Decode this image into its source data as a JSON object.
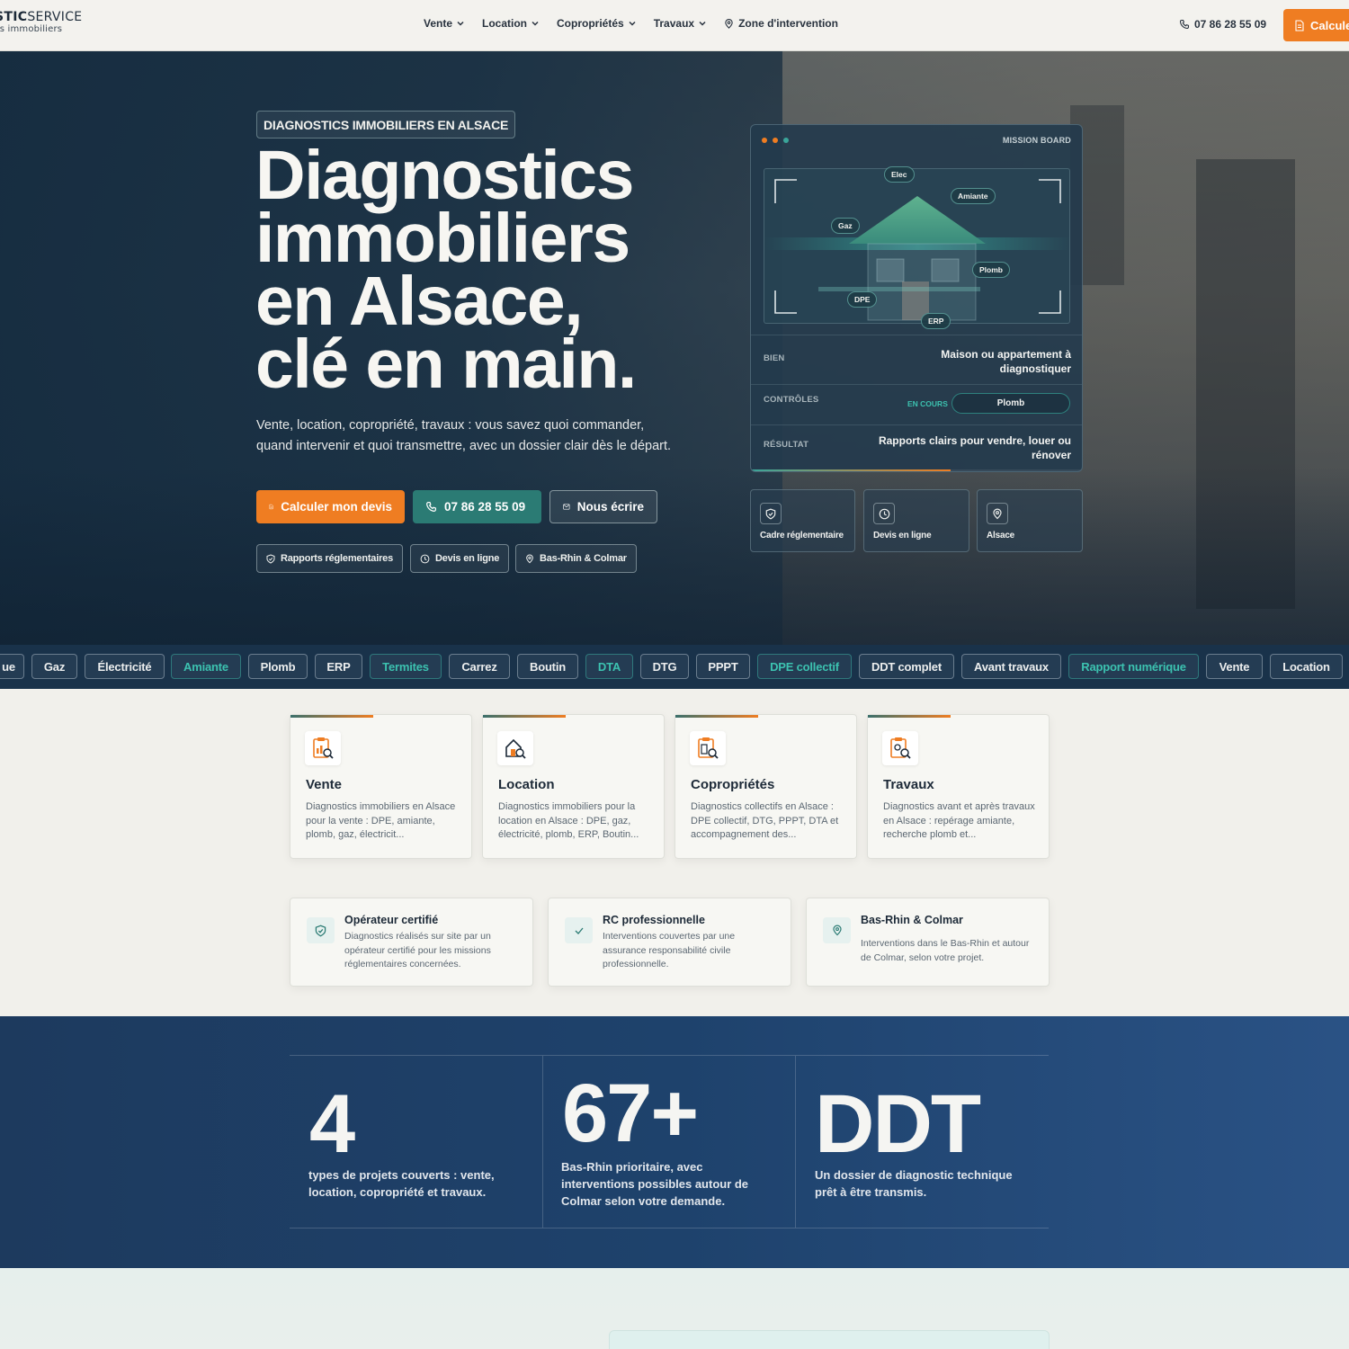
{
  "header": {
    "logo_bold": "STIC",
    "logo_regular": "SERVICE",
    "logo_sub": "cs immobiliers",
    "nav": [
      {
        "label": "Vente"
      },
      {
        "label": "Location"
      },
      {
        "label": "Copropriétés"
      },
      {
        "label": "Travaux"
      },
      {
        "label": "Zone d'intervention"
      }
    ],
    "phone": "07 86 28 55 09",
    "cta": "Calcule"
  },
  "hero": {
    "eyebrow": "DIAGNOSTICS IMMOBILIERS EN ALSACE",
    "title_lines": [
      "Diagnostics",
      "immobiliers",
      "en Alsace,",
      "clé en main."
    ],
    "lead": "Vente, location, copropriété, travaux : vous savez quoi commander, quand intervenir et quoi transmettre, avec un dossier clair dès le départ.",
    "buttons": {
      "quote": "Calculer mon devis",
      "phone": "07 86 28 55 09",
      "write": "Nous écrire"
    },
    "pills": [
      "Rapports réglementaires",
      "Devis en ligne",
      "Bas-Rhin & Colmar"
    ]
  },
  "board": {
    "title": "MISSION BOARD",
    "tags": [
      "Elec",
      "Amiante",
      "Gaz",
      "Plomb",
      "DPE",
      "ERP"
    ],
    "rows": [
      {
        "label": "BIEN",
        "value": "Maison ou appartement à diagnostiquer"
      },
      {
        "label": "CONTRÔLES",
        "status": "EN COURS",
        "value": "Plomb"
      },
      {
        "label": "RÉSULTAT",
        "value": "Rapports clairs pour vendre, louer ou rénover"
      }
    ],
    "progress": 0.6
  },
  "mini_cards": [
    "Cadre réglementaire",
    "Devis en ligne",
    "Alsace"
  ],
  "ticker": [
    "ue",
    "Gaz",
    "Électricité",
    "Amiante",
    "Plomb",
    "ERP",
    "Termites",
    "Carrez",
    "Boutin",
    "DTA",
    "DTG",
    "PPPT",
    "DPE collectif",
    "DDT complet",
    "Avant travaux",
    "Rapport numérique",
    "Vente",
    "Location"
  ],
  "cards": [
    {
      "title": "Vente",
      "desc": "Diagnostics immobiliers en Alsace pour la vente : DPE, amiante, plomb, gaz, électricit..."
    },
    {
      "title": "Location",
      "desc": "Diagnostics immobiliers pour la location en Alsace : DPE, gaz, électricité, plomb, ERP, Boutin..."
    },
    {
      "title": "Copropriétés",
      "desc": "Diagnostics collectifs en Alsace : DPE collectif, DTG, PPPT, DTA et accompagnement des..."
    },
    {
      "title": "Travaux",
      "desc": "Diagnostics avant et après travaux en Alsace : repérage amiante, recherche plomb et..."
    }
  ],
  "features": [
    {
      "title": "Opérateur certifié",
      "desc": "Diagnostics réalisés sur site par un opérateur certifié pour les missions réglementaires concernées."
    },
    {
      "title": "RC professionnelle",
      "desc": "Interventions couvertes par une assurance responsabilité civile professionnelle."
    },
    {
      "title": "Bas-Rhin & Colmar",
      "desc": "Interventions dans le Bas-Rhin et autour de Colmar, selon votre projet."
    }
  ],
  "stats": [
    {
      "value": "4",
      "text": "types de projets couverts : vente, location, copropriété et travaux."
    },
    {
      "value": "67+",
      "text": "Bas-Rhin prioritaire, avec interventions possibles autour de Colmar selon votre demande."
    },
    {
      "value": "DDT",
      "text": "Un dossier de diagnostic technique prêt à être transmis."
    }
  ],
  "colors": {
    "accent_orange": "#ef7d22",
    "accent_teal": "#2b7b74",
    "navy": "#19324a",
    "stats_blue": "#1e426c"
  }
}
